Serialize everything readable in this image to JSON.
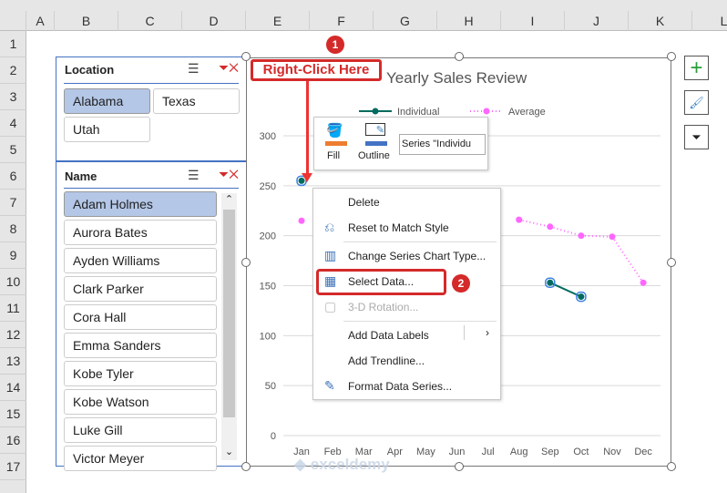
{
  "columns": [
    "A",
    "B",
    "C",
    "D",
    "E",
    "F",
    "G",
    "H",
    "I",
    "J",
    "K",
    "L"
  ],
  "rows": [
    "1",
    "2",
    "3",
    "4",
    "5",
    "6",
    "7",
    "8",
    "9",
    "10",
    "11",
    "12",
    "13",
    "14",
    "15",
    "16",
    "17"
  ],
  "location_slicer": {
    "title": "Location",
    "items": [
      {
        "label": "Alabama",
        "selected": true
      },
      {
        "label": "Texas",
        "selected": false
      },
      {
        "label": "Utah",
        "selected": false
      }
    ]
  },
  "name_slicer": {
    "title": "Name",
    "items": [
      {
        "label": "Adam Holmes",
        "selected": true
      },
      {
        "label": "Aurora Bates"
      },
      {
        "label": "Ayden Williams"
      },
      {
        "label": "Clark Parker"
      },
      {
        "label": "Cora Hall"
      },
      {
        "label": "Emma Sanders"
      },
      {
        "label": "Kobe Tyler"
      },
      {
        "label": "Kobe Watson"
      },
      {
        "label": "Luke Gill"
      },
      {
        "label": "Victor Meyer"
      }
    ]
  },
  "callout": {
    "label": "Right-Click Here",
    "step1": "1",
    "step2": "2"
  },
  "mini_toolbar": {
    "fill": "Fill",
    "outline": "Outline",
    "series_select": "Series \"Individu"
  },
  "context_menu": [
    {
      "label": "Delete",
      "icon": "none"
    },
    {
      "label": "Reset to Match Style",
      "icon": "reset-icon"
    },
    {
      "label": "Change Series Chart Type...",
      "icon": "chart-type-icon"
    },
    {
      "label": "Select Data...",
      "icon": "select-data-icon"
    },
    {
      "label": "3-D Rotation...",
      "icon": "rotation-icon",
      "disabled": true
    },
    {
      "label": "Add Data Labels",
      "icon": "none",
      "submenu": true
    },
    {
      "label": "Add Trendline...",
      "icon": "none"
    },
    {
      "label": "Format Data Series...",
      "icon": "format-icon"
    }
  ],
  "watermark": "exceldemy",
  "colors": {
    "individual": "#006b5f",
    "average": "#ff66ff",
    "accent": "#4472c4",
    "callout": "#d42a2a"
  },
  "chart_data": {
    "type": "line",
    "title": "Yearly Sales Review",
    "categories": [
      "Jan",
      "Feb",
      "Mar",
      "Apr",
      "May",
      "Jun",
      "Jul",
      "Aug",
      "Sep",
      "Oct",
      "Nov",
      "Dec"
    ],
    "series": [
      {
        "name": "Individual",
        "values": [
          255,
          null,
          null,
          null,
          null,
          null,
          null,
          null,
          153,
          139,
          null,
          null
        ]
      },
      {
        "name": "Average",
        "values": [
          215,
          null,
          null,
          null,
          null,
          null,
          null,
          216,
          209,
          200,
          199,
          153
        ]
      }
    ],
    "yticks": [
      "0",
      "50",
      "100",
      "150",
      "200",
      "250",
      "300"
    ],
    "ylim": [
      0,
      300
    ],
    "legend": "top",
    "grid": true
  }
}
